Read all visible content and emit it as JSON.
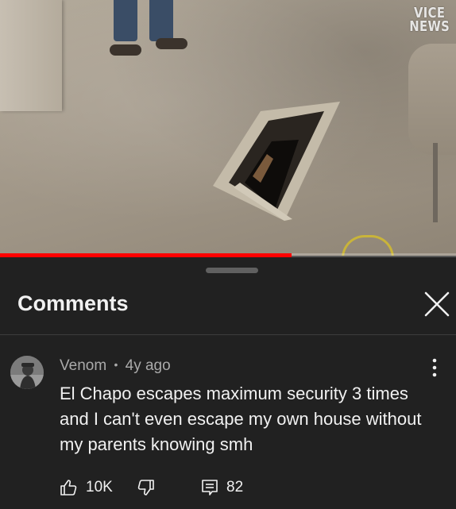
{
  "video": {
    "watermark_line1": "VICE",
    "watermark_line2": "NEWS",
    "progress_fraction": 0.64
  },
  "comments_panel": {
    "title": "Comments",
    "close_icon": "close-icon"
  },
  "comment": {
    "author": "Venom",
    "separator": "•",
    "time": "4y ago",
    "text": "El Chapo escapes maximum security 3 times and I can't even escape my own house without my parents knowing smh",
    "likes": "10K",
    "replies": "82",
    "icons": [
      "like-icon",
      "dislike-icon",
      "reply-icon",
      "more-vert-icon"
    ]
  },
  "colors": {
    "panel_bg": "#212121",
    "progress": "#ff0000",
    "text_primary": "#f1f1f1",
    "text_secondary": "#aaaaaa"
  }
}
